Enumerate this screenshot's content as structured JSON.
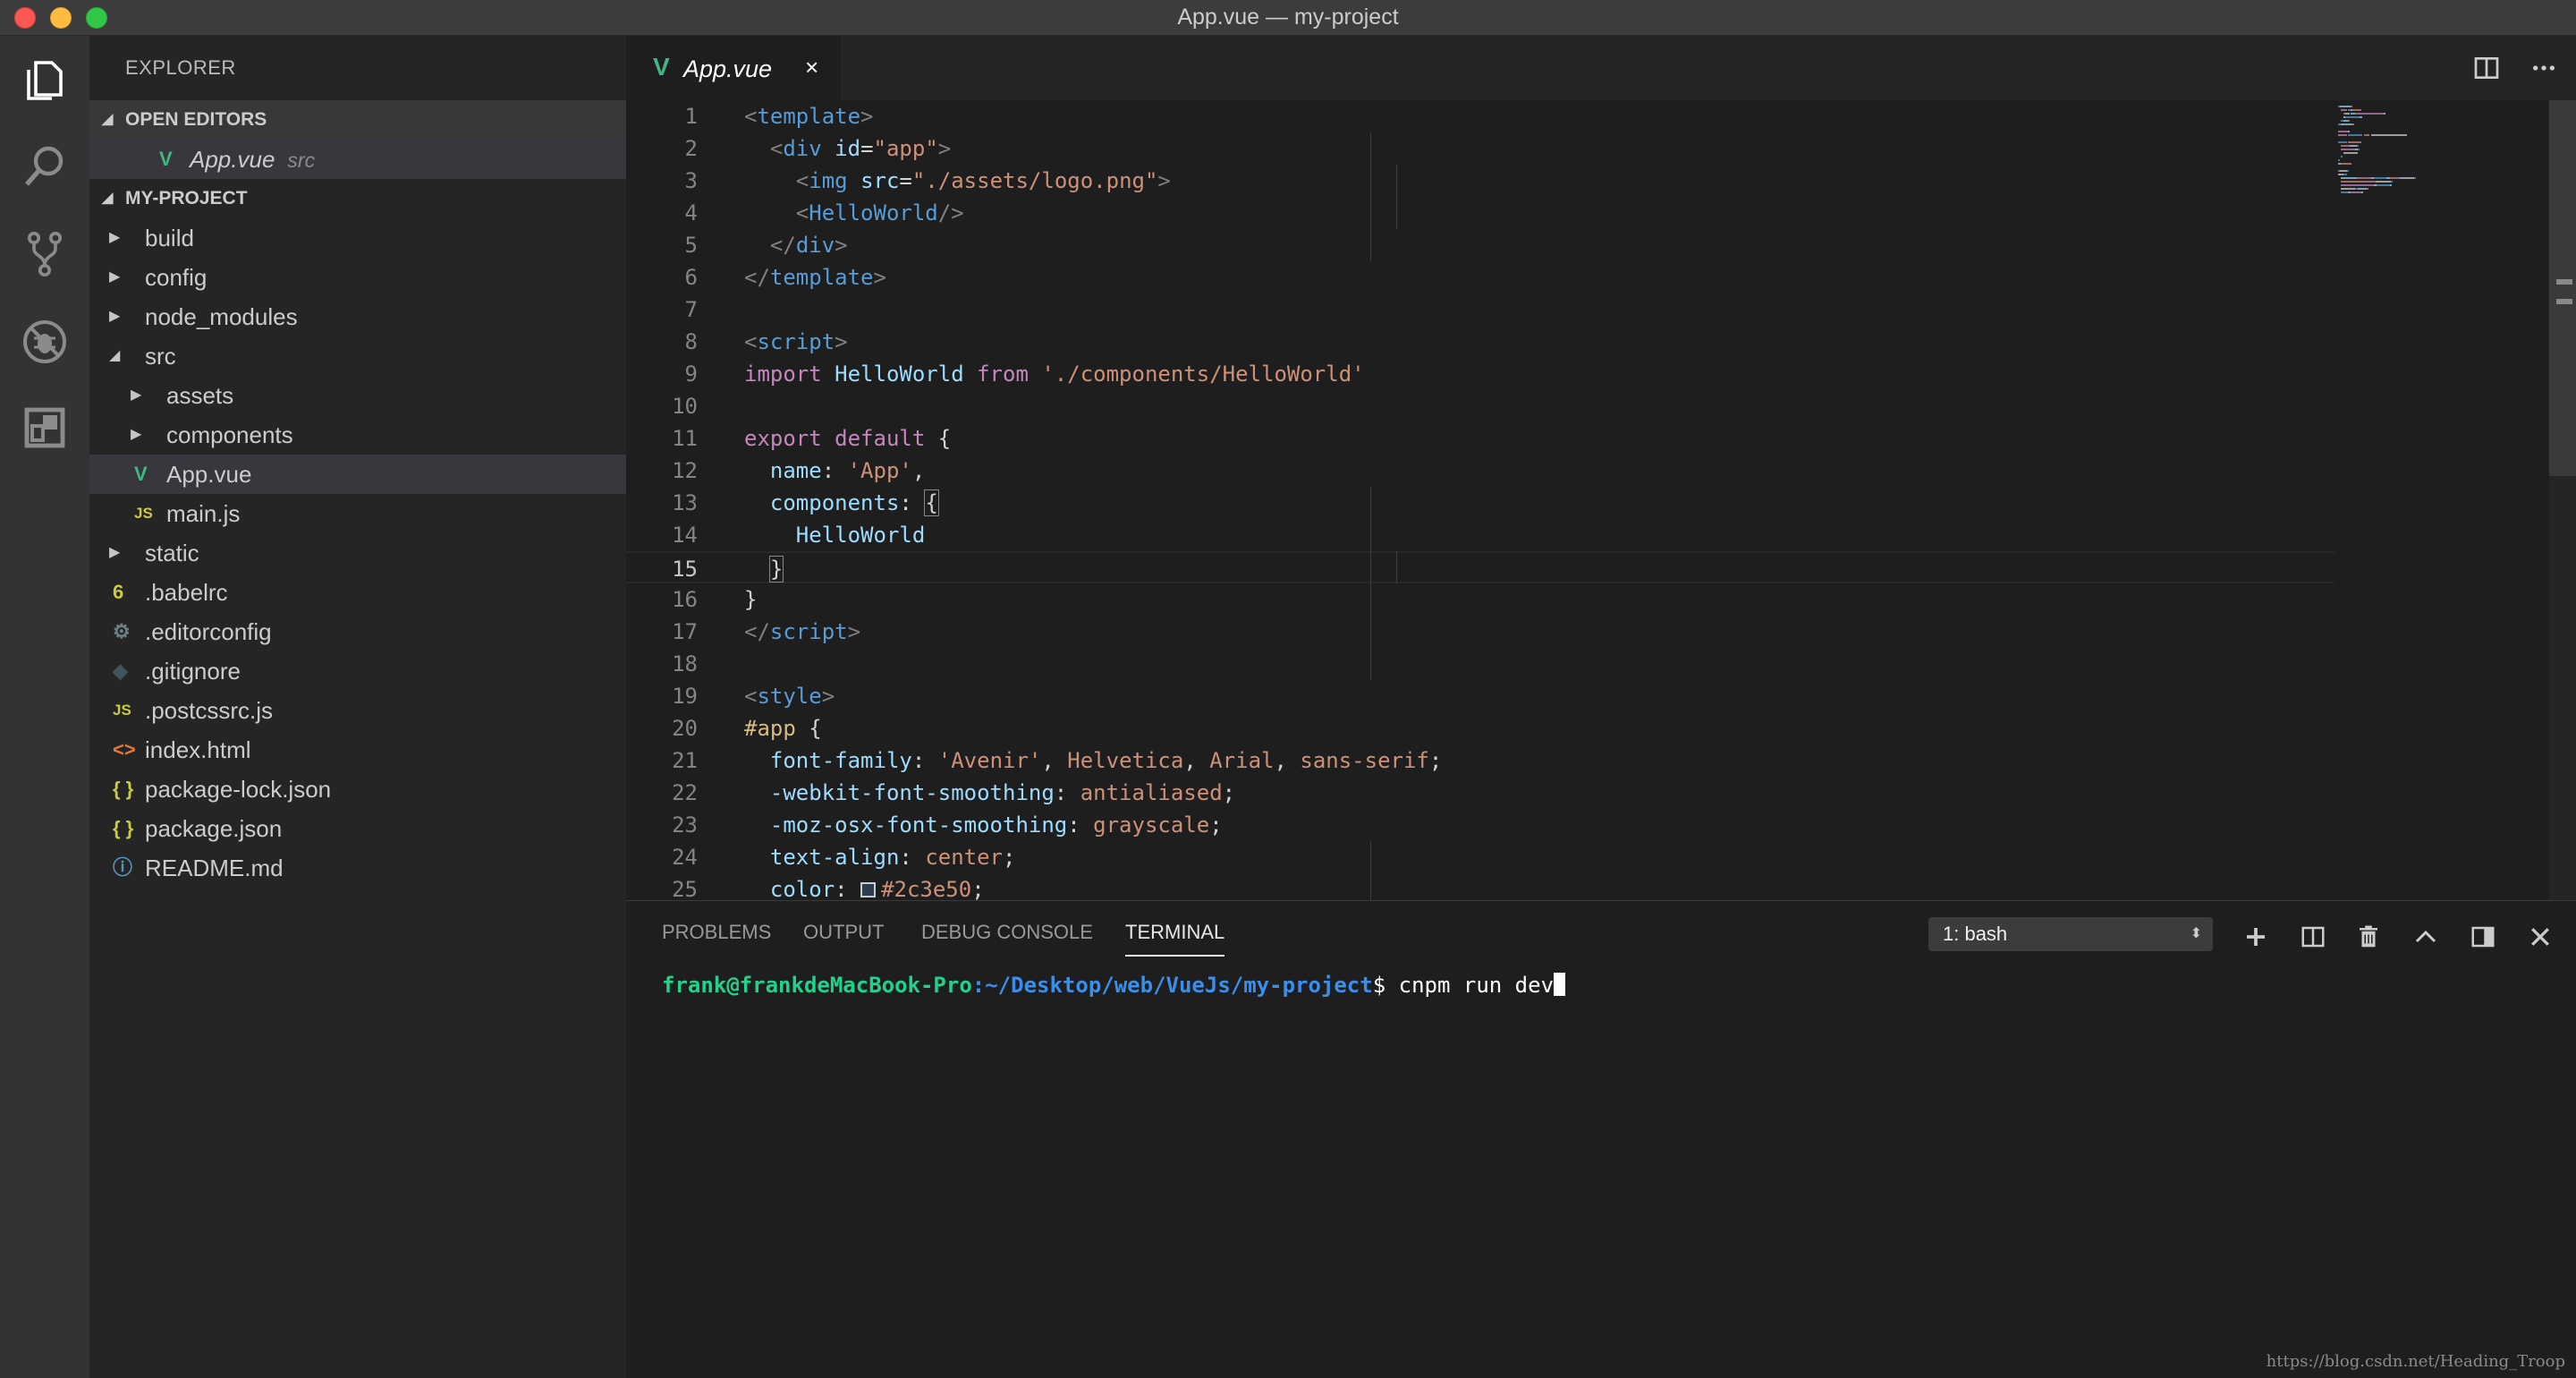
{
  "window": {
    "title": "App.vue — my-project"
  },
  "sidebar": {
    "header": "EXPLORER",
    "open_editors": {
      "label": "OPEN EDITORS",
      "items": [
        {
          "name": "App.vue",
          "desc": "src"
        }
      ]
    },
    "project": {
      "label": "MY-PROJECT",
      "tree": [
        {
          "name": "build",
          "type": "folder",
          "depth": 0,
          "expanded": false
        },
        {
          "name": "config",
          "type": "folder",
          "depth": 0,
          "expanded": false
        },
        {
          "name": "node_modules",
          "type": "folder",
          "depth": 0,
          "expanded": false
        },
        {
          "name": "src",
          "type": "folder",
          "depth": 0,
          "expanded": true
        },
        {
          "name": "assets",
          "type": "folder",
          "depth": 1,
          "expanded": false
        },
        {
          "name": "components",
          "type": "folder",
          "depth": 1,
          "expanded": false
        },
        {
          "name": "App.vue",
          "type": "vue",
          "depth": 1,
          "selected": true
        },
        {
          "name": "main.js",
          "type": "js",
          "depth": 1
        },
        {
          "name": "static",
          "type": "folder",
          "depth": 0,
          "expanded": false
        },
        {
          "name": ".babelrc",
          "type": "babel",
          "depth": 0
        },
        {
          "name": ".editorconfig",
          "type": "gear",
          "depth": 0
        },
        {
          "name": ".gitignore",
          "type": "git",
          "depth": 0
        },
        {
          "name": ".postcssrc.js",
          "type": "js",
          "depth": 0
        },
        {
          "name": "index.html",
          "type": "html",
          "depth": 0
        },
        {
          "name": "package-lock.json",
          "type": "json",
          "depth": 0
        },
        {
          "name": "package.json",
          "type": "json",
          "depth": 0
        },
        {
          "name": "README.md",
          "type": "info",
          "depth": 0
        }
      ]
    },
    "icon_glyphs": {
      "vue": "V",
      "js": "JS",
      "json": "{ }",
      "html": "<>",
      "gear": "⚙",
      "git": "◆",
      "babel": "6",
      "info": "ⓘ"
    }
  },
  "editor": {
    "active_tab": "App.vue",
    "tab_close": "×",
    "current_line": 15,
    "lines": [
      [
        [
          "c-punc",
          "<"
        ],
        [
          "c-tag",
          "template"
        ],
        [
          "c-punc",
          ">"
        ]
      ],
      [
        [
          "c-plain",
          "  "
        ],
        [
          "c-punc",
          "<"
        ],
        [
          "c-tag",
          "div"
        ],
        [
          "c-plain",
          " "
        ],
        [
          "c-attr",
          "id"
        ],
        [
          "c-plain",
          "="
        ],
        [
          "c-str",
          "\"app\""
        ],
        [
          "c-punc",
          ">"
        ]
      ],
      [
        [
          "c-plain",
          "    "
        ],
        [
          "c-punc",
          "<"
        ],
        [
          "c-tag",
          "img"
        ],
        [
          "c-plain",
          " "
        ],
        [
          "c-attr",
          "src"
        ],
        [
          "c-plain",
          "="
        ],
        [
          "c-str",
          "\"./assets/logo.png\""
        ],
        [
          "c-punc",
          ">"
        ]
      ],
      [
        [
          "c-plain",
          "    "
        ],
        [
          "c-punc",
          "<"
        ],
        [
          "c-tag",
          "HelloWorld"
        ],
        [
          "c-punc",
          "/>"
        ]
      ],
      [
        [
          "c-plain",
          "  "
        ],
        [
          "c-punc",
          "</"
        ],
        [
          "c-tag",
          "div"
        ],
        [
          "c-punc",
          ">"
        ]
      ],
      [
        [
          "c-punc",
          "</"
        ],
        [
          "c-tag",
          "template"
        ],
        [
          "c-punc",
          ">"
        ]
      ],
      [],
      [
        [
          "c-punc",
          "<"
        ],
        [
          "c-tag",
          "script"
        ],
        [
          "c-punc",
          ">"
        ]
      ],
      [
        [
          "c-kw",
          "import"
        ],
        [
          "c-plain",
          " "
        ],
        [
          "c-var",
          "HelloWorld"
        ],
        [
          "c-plain",
          " "
        ],
        [
          "c-kw",
          "from"
        ],
        [
          "c-plain",
          " "
        ],
        [
          "c-str",
          "'./components/HelloWorld'"
        ]
      ],
      [],
      [
        [
          "c-kw",
          "export"
        ],
        [
          "c-plain",
          " "
        ],
        [
          "c-kw",
          "default"
        ],
        [
          "c-plain",
          " {"
        ]
      ],
      [
        [
          "c-plain",
          "  "
        ],
        [
          "c-prop",
          "name"
        ],
        [
          "c-plain",
          ": "
        ],
        [
          "c-str",
          "'App'"
        ],
        [
          "c-plain",
          ","
        ]
      ],
      [
        [
          "c-plain",
          "  "
        ],
        [
          "c-prop",
          "components"
        ],
        [
          "c-plain",
          ": "
        ],
        [
          "brk",
          "{"
        ]
      ],
      [
        [
          "c-plain",
          "    "
        ],
        [
          "c-var",
          "HelloWorld"
        ]
      ],
      [
        [
          "c-plain",
          "  "
        ],
        [
          "brk",
          "}"
        ]
      ],
      [
        [
          "c-plain",
          "}"
        ]
      ],
      [
        [
          "c-punc",
          "</"
        ],
        [
          "c-tag",
          "script"
        ],
        [
          "c-punc",
          ">"
        ]
      ],
      [],
      [
        [
          "c-punc",
          "<"
        ],
        [
          "c-tag",
          "style"
        ],
        [
          "c-punc",
          ">"
        ]
      ],
      [
        [
          "c-sel",
          "#app"
        ],
        [
          "c-plain",
          " {"
        ]
      ],
      [
        [
          "c-plain",
          "  "
        ],
        [
          "c-prop",
          "font-family"
        ],
        [
          "c-plain",
          ": "
        ],
        [
          "c-str",
          "'Avenir'"
        ],
        [
          "c-plain",
          ", "
        ],
        [
          "c-str",
          "Helvetica"
        ],
        [
          "c-plain",
          ", "
        ],
        [
          "c-str",
          "Arial"
        ],
        [
          "c-plain",
          ", "
        ],
        [
          "c-str",
          "sans-serif"
        ],
        [
          "c-plain",
          ";"
        ]
      ],
      [
        [
          "c-plain",
          "  "
        ],
        [
          "c-prop",
          "-webkit-font-smoothing"
        ],
        [
          "c-plain",
          ": "
        ],
        [
          "c-str",
          "antialiased"
        ],
        [
          "c-plain",
          ";"
        ]
      ],
      [
        [
          "c-plain",
          "  "
        ],
        [
          "c-prop",
          "-moz-osx-font-smoothing"
        ],
        [
          "c-plain",
          ": "
        ],
        [
          "c-str",
          "grayscale"
        ],
        [
          "c-plain",
          ";"
        ]
      ],
      [
        [
          "c-plain",
          "  "
        ],
        [
          "c-prop",
          "text-align"
        ],
        [
          "c-plain",
          ": "
        ],
        [
          "c-str",
          "center"
        ],
        [
          "c-plain",
          ";"
        ]
      ],
      [
        [
          "c-plain",
          "  "
        ],
        [
          "c-prop",
          "color"
        ],
        [
          "c-plain",
          ": "
        ],
        [
          "swatch",
          ""
        ],
        [
          "c-str",
          "#2c3e50"
        ],
        [
          "c-plain",
          ";"
        ]
      ]
    ]
  },
  "panel": {
    "tabs": [
      "PROBLEMS",
      "OUTPUT",
      "DEBUG CONSOLE",
      "TERMINAL"
    ],
    "active_tab": "TERMINAL",
    "terminal_select": "1: bash",
    "select_arrows": "⬍",
    "terminal": {
      "user": "frank@frankdeMacBook-Pro",
      "path": ":~/Desktop/web/VueJs/my-project",
      "prompt": "$ ",
      "command": "cnpm run dev"
    }
  },
  "watermark": "https://blog.csdn.net/Heading_Troop",
  "colors": {
    "titlebar": "#3c3c3c",
    "activitybar": "#333333",
    "sidebar": "#252526",
    "editor": "#1e1e1e",
    "vue_green": "#41b883"
  }
}
